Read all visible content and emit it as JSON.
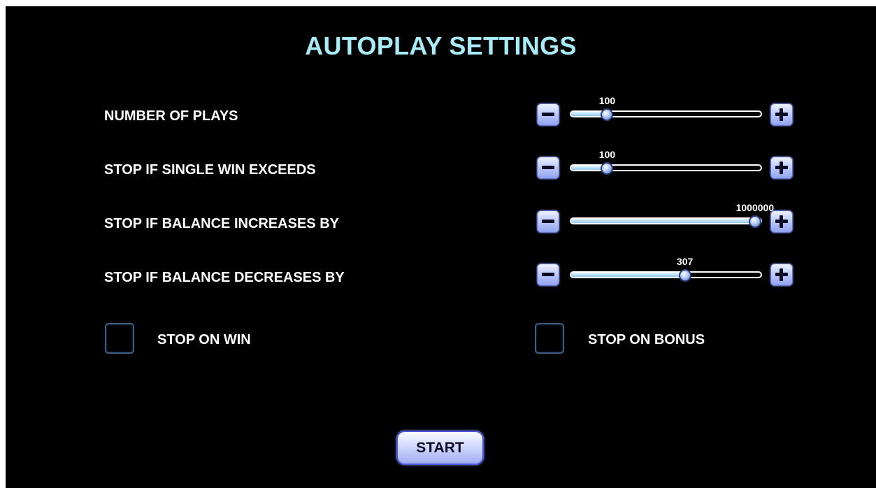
{
  "title": "AUTOPLAY SETTINGS",
  "colors": {
    "title": "#a7ecf7",
    "background": "#000000",
    "button": "#c4d0ff",
    "slider_fill": "#8fc8ee",
    "checkbox_border": "#3f5f88"
  },
  "rows": [
    {
      "label": "NUMBER OF PLAYS",
      "value": "100",
      "level": 0.19,
      "minus_icon": "minus-icon",
      "plus_icon": "plus-icon"
    },
    {
      "label": "STOP IF SINGLE WIN EXCEEDS",
      "value": "100",
      "level": 0.19,
      "minus_icon": "minus-icon",
      "plus_icon": "plus-icon"
    },
    {
      "label": "STOP IF BALANCE INCREASES BY",
      "value": "1000000",
      "level": 0.97,
      "minus_icon": "minus-icon",
      "plus_icon": "plus-icon"
    },
    {
      "label": "STOP IF BALANCE DECREASES BY",
      "value": "307",
      "level": 0.6,
      "minus_icon": "minus-icon",
      "plus_icon": "plus-icon"
    }
  ],
  "checkboxes": {
    "stop_on_win": {
      "label": "STOP ON WIN",
      "checked": false
    },
    "stop_on_bonus": {
      "label": "STOP ON BONUS",
      "checked": false
    }
  },
  "start_button": {
    "label": "START"
  }
}
